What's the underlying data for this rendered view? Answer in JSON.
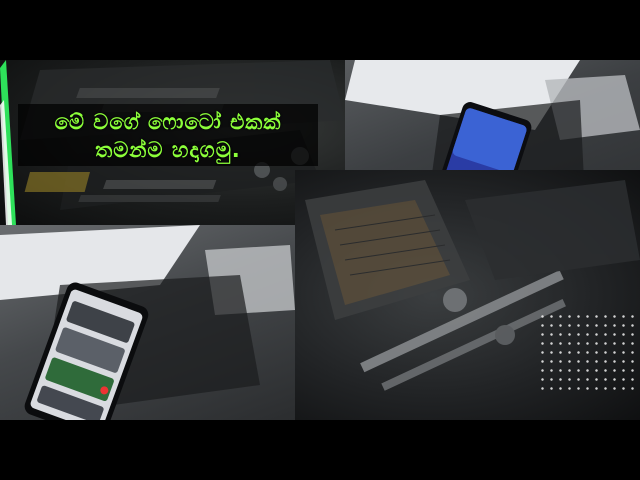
{
  "caption": {
    "line1": "මේ වගේ ෆොටෝ එකක්",
    "line2": "තමන්ම හදාගමු."
  },
  "colors": {
    "caption_text": "#8cff3a",
    "caption_background": "#000000",
    "accent_bar": "#2ee15a",
    "frame_background": "#000000"
  }
}
